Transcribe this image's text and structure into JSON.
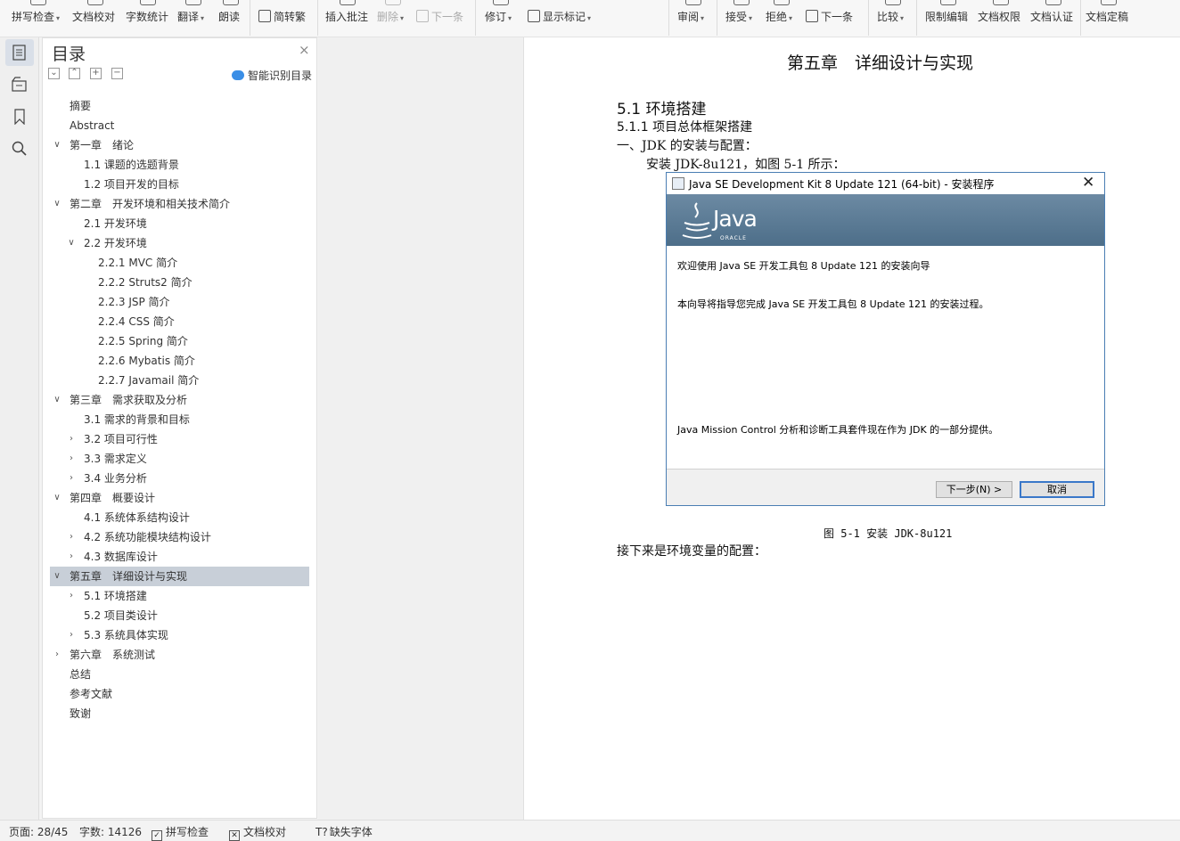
{
  "toolbar": {
    "spell_check": "拼写检查",
    "doc_proof": "文档校对",
    "word_count": "字数统计",
    "translate": "翻译",
    "read_aloud": "朗读",
    "simp_trad": "简转繁",
    "insert_comment": "插入批注",
    "delete": "删除",
    "next_item": "下一条",
    "revise": "修订",
    "show_marks": "显示标记",
    "review": "审阅",
    "accept": "接受",
    "reject": "拒绝",
    "next_change": "下一条",
    "compare": "比较",
    "restrict_edit": "限制编辑",
    "doc_permission": "文档权限",
    "doc_certify": "文档认证",
    "doc_finalize": "文档定稿"
  },
  "toc": {
    "title": "目录",
    "close": "×",
    "smart_toc": "智能识别目录",
    "items": [
      {
        "label": "摘要",
        "level": 0,
        "chevron": ""
      },
      {
        "label": "Abstract",
        "level": 0,
        "chevron": ""
      },
      {
        "label": "第一章　绪论",
        "level": 0,
        "chevron": "down"
      },
      {
        "label": "1.1  课题的选题背景",
        "level": 1,
        "chevron": ""
      },
      {
        "label": "1.2  项目开发的目标",
        "level": 1,
        "chevron": ""
      },
      {
        "label": "第二章　开发环境和相关技术简介",
        "level": 0,
        "chevron": "down"
      },
      {
        "label": "2.1  开发环境",
        "level": 1,
        "chevron": ""
      },
      {
        "label": "2.2  开发环境",
        "level": 1,
        "chevron": "down"
      },
      {
        "label": "2.2.1 MVC 简介",
        "level": 2,
        "chevron": ""
      },
      {
        "label": "2.2.2 Struts2 简介",
        "level": 2,
        "chevron": ""
      },
      {
        "label": "2.2.3 JSP 简介",
        "level": 2,
        "chevron": ""
      },
      {
        "label": "2.2.4 CSS 简介",
        "level": 2,
        "chevron": ""
      },
      {
        "label": "2.2.5 Spring 简介",
        "level": 2,
        "chevron": ""
      },
      {
        "label": "2.2.6 Mybatis 简介",
        "level": 2,
        "chevron": ""
      },
      {
        "label": "2.2.7 Javamail 简介",
        "level": 2,
        "chevron": ""
      },
      {
        "label": "第三章　需求获取及分析",
        "level": 0,
        "chevron": "down"
      },
      {
        "label": "3.1  需求的背景和目标",
        "level": 1,
        "chevron": ""
      },
      {
        "label": "3.2  项目可行性",
        "level": 1,
        "chevron": "right"
      },
      {
        "label": "3.3  需求定义",
        "level": 1,
        "chevron": "right"
      },
      {
        "label": "3.4  业务分析",
        "level": 1,
        "chevron": "right"
      },
      {
        "label": "第四章　概要设计",
        "level": 0,
        "chevron": "down"
      },
      {
        "label": "4.1  系统体系结构设计",
        "level": 1,
        "chevron": ""
      },
      {
        "label": "4.2  系统功能模块结构设计",
        "level": 1,
        "chevron": "right"
      },
      {
        "label": "4.3  数据库设计",
        "level": 1,
        "chevron": "right"
      },
      {
        "label": "第五章　详细设计与实现",
        "level": 0,
        "chevron": "down",
        "selected": true
      },
      {
        "label": "5.1  环境搭建",
        "level": 1,
        "chevron": "right"
      },
      {
        "label": "5.2  项目类设计",
        "level": 1,
        "chevron": ""
      },
      {
        "label": "5.3  系统具体实现",
        "level": 1,
        "chevron": "right"
      },
      {
        "label": "第六章　系统测试",
        "level": 0,
        "chevron": "right"
      },
      {
        "label": "总结",
        "level": 0,
        "chevron": ""
      },
      {
        "label": "参考文献",
        "level": 0,
        "chevron": ""
      },
      {
        "label": "致谢",
        "level": 0,
        "chevron": ""
      }
    ]
  },
  "document": {
    "chapter_title": "第五章　详细设计与实现",
    "h1": "5.1  环境搭建",
    "h2": "5.1.1  项目总体框架搭建",
    "p1": "一、JDK 的安装与配置：",
    "p2": "安装 JDK-8u121，如图 5-1 所示：",
    "caption": "图 5-1  安装 JDK-8u121",
    "p3": "接下来是环境变量的配置："
  },
  "installer": {
    "title": "Java SE Development Kit 8 Update 121 (64-bit) - 安装程序",
    "close": "✕",
    "brand": "Java",
    "vendor": "ORACLE",
    "welcome": "欢迎使用 Java SE 开发工具包 8 Update 121 的安装向导",
    "guide": "本向导将指导您完成 Java SE 开发工具包 8 Update 121 的安装过程。",
    "mission_control": "Java Mission Control 分析和诊断工具套件现在作为 JDK 的一部分提供。",
    "next_button": "下一步(N) >",
    "cancel_button": "取消"
  },
  "statusbar": {
    "page": "页面: 28/45",
    "words": "字数: 14126",
    "spell_check": "拼写检查",
    "doc_proof": "文档校对",
    "missing_font": "缺失字体"
  }
}
